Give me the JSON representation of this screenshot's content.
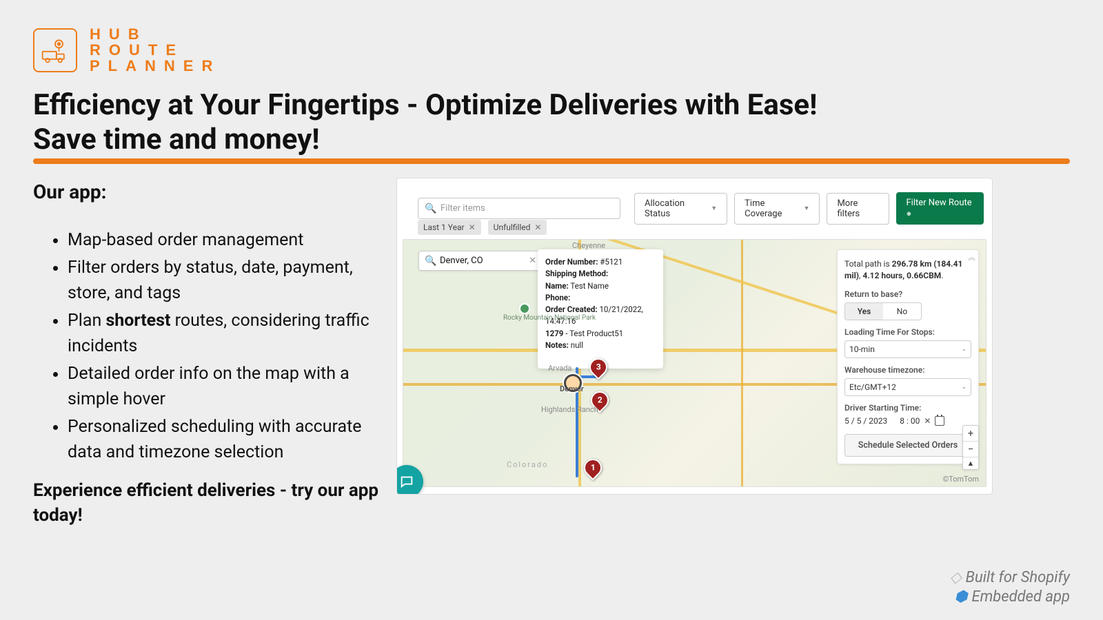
{
  "brand": {
    "l1": "HUB",
    "l2": "ROUTE",
    "l3": "PLANNER"
  },
  "headline_l1": "Efficiency at Your Fingertips - Optimize Deliveries with Ease!",
  "headline_l2": "Save time and money!",
  "our_app": "Our app:",
  "bullets": {
    "b1": "Map-based order management",
    "b2": "Filter orders by status, date, payment, store, and tags",
    "b3_pre": "Plan ",
    "b3_bold": "shortest",
    "b3_post": " routes, considering traffic incidents",
    "b4": "Detailed order info on the map with a simple hover",
    "b5": "Personalized scheduling with accurate data and timezone selection"
  },
  "cta": "Experience efficient deliveries - try our app today!",
  "footer": {
    "shopify": "Built for Shopify",
    "embedded": "Embedded app"
  },
  "toolbar": {
    "filter_placeholder": "Filter items",
    "alloc": "Allocation Status",
    "time": "Time Coverage",
    "more": "More filters",
    "new_route": "Filter New Route"
  },
  "chips": {
    "c1": "Last 1 Year",
    "c2": "Unfulfilled"
  },
  "map": {
    "search_value": "Denver, CO",
    "labels": {
      "cheyenne": "Cheyenne",
      "arvada": "Arvada",
      "denver": "Denver",
      "highlands": "Highlands Ranch",
      "colorado": "Colorado",
      "park": "Rocky Mountain National Park"
    },
    "pins": {
      "p1": "1",
      "p2": "2",
      "p3": "3"
    },
    "attrib": "©TomTom"
  },
  "tooltip": {
    "order_no_label": "Order Number:",
    "order_no": "#5121",
    "ship_label": "Shipping Method:",
    "name_label": "Name:",
    "name": "Test Name",
    "phone_label": "Phone:",
    "created_label": "Order Created:",
    "created": "10/21/2022, 14:47:16",
    "line_item": "1279 - Test Product51",
    "notes_label": "Notes:",
    "notes": "null"
  },
  "panel": {
    "summary_pre": "Total path is ",
    "summary_bold1": "296.78 km (184.41 mil)",
    "summary_mid": ", ",
    "summary_bold2": "4.12 hours, 0.66CBM",
    "summary_post": ".",
    "return_label": "Return to base?",
    "yes": "Yes",
    "no": "No",
    "loading_label": "Loading Time For Stops:",
    "loading_value": "10-min",
    "tz_label": "Warehouse timezone:",
    "tz_value": "Etc/GMT+12",
    "start_label": "Driver Starting Time:",
    "date": "5 / 5 / 2023",
    "time": "8 : 00",
    "schedule": "Schedule Selected Orders"
  },
  "zoom": {
    "in": "+",
    "out": "−",
    "reset": "⤴"
  }
}
